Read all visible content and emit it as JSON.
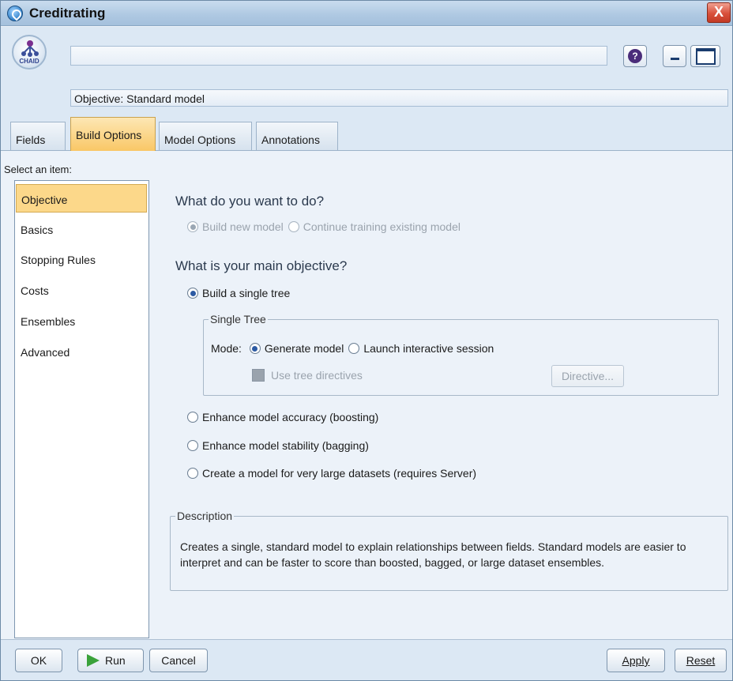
{
  "window": {
    "title": "Creditrating",
    "close_label": "X"
  },
  "header": {
    "node_icon_label": "CHAID",
    "name_value": "",
    "objective_line": "Objective: Standard model",
    "help_label": "?"
  },
  "tabs": [
    {
      "label": "Fields",
      "active": false
    },
    {
      "label": "Build Options",
      "active": true
    },
    {
      "label": "Model Options",
      "active": false
    },
    {
      "label": "Annotations",
      "active": false
    }
  ],
  "sidebar": {
    "select_label": "Select an item:",
    "items": [
      {
        "label": "Objective",
        "selected": true
      },
      {
        "label": "Basics",
        "selected": false
      },
      {
        "label": "Stopping Rules",
        "selected": false
      },
      {
        "label": "Costs",
        "selected": false
      },
      {
        "label": "Ensembles",
        "selected": false
      },
      {
        "label": "Advanced",
        "selected": false
      }
    ]
  },
  "main": {
    "q1": "What do you want to do?",
    "build_new": "Build new model",
    "continue_training": "Continue training existing model",
    "q2": "What is your main objective?",
    "single_tree": "Build a single tree",
    "group_title": "Single Tree",
    "mode_label": "Mode:",
    "generate_model": "Generate model",
    "launch_interactive": "Launch interactive session",
    "use_tree_directives": "Use tree directives",
    "directive_button": "Directive...",
    "boosting": "Enhance model accuracy (boosting)",
    "bagging": "Enhance model stability (bagging)",
    "large_datasets": "Create a model for very large datasets (requires Server)",
    "description_title": "Description",
    "description_text": "Creates a single, standard model to explain relationships between fields.  Standard models are easier to interpret and can be faster to score than boosted, bagged, or large dataset ensembles."
  },
  "footer": {
    "ok": "OK",
    "run": "Run",
    "cancel": "Cancel",
    "apply": "Apply",
    "reset": "Reset"
  },
  "colors": {
    "selected_bg": "#fcd88a",
    "window_bg": "#ecf2f9",
    "close_red": "#d9503b",
    "run_green": "#3aa23a"
  }
}
